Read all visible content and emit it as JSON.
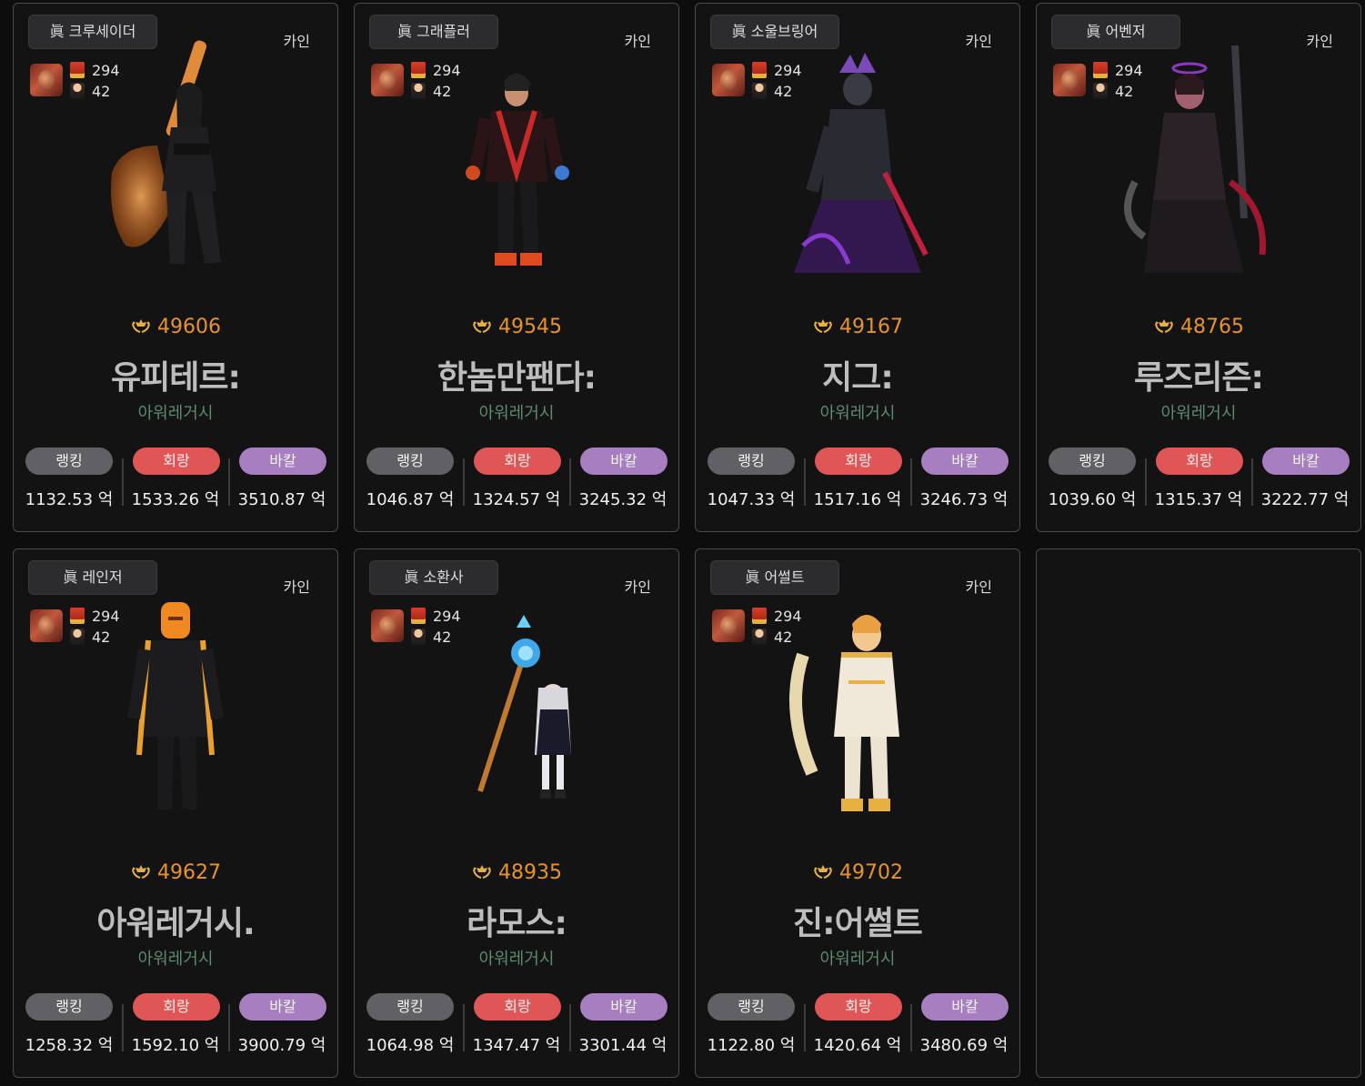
{
  "cards": [
    {
      "job": "眞 크루세이더",
      "server": "카인",
      "lv": "294",
      "lv2": "42",
      "fame": "49606",
      "name": "유피테르:",
      "guild": "아워레거시",
      "buttons": [
        "랭킹",
        "회랑",
        "바칼"
      ],
      "values": [
        "1132.53 억",
        "1533.26 억",
        "3510.87 억"
      ]
    },
    {
      "job": "眞 그래플러",
      "server": "카인",
      "lv": "294",
      "lv2": "42",
      "fame": "49545",
      "name": "한놈만팬다:",
      "guild": "아워레거시",
      "buttons": [
        "랭킹",
        "회랑",
        "바칼"
      ],
      "values": [
        "1046.87 억",
        "1324.57 억",
        "3245.32 억"
      ]
    },
    {
      "job": "眞 소울브링어",
      "server": "카인",
      "lv": "294",
      "lv2": "42",
      "fame": "49167",
      "name": "지그:",
      "guild": "아워레거시",
      "buttons": [
        "랭킹",
        "회랑",
        "바칼"
      ],
      "values": [
        "1047.33 억",
        "1517.16 억",
        "3246.73 억"
      ]
    },
    {
      "job": "眞 어벤저",
      "server": "카인",
      "lv": "294",
      "lv2": "42",
      "fame": "48765",
      "name": "루즈리즌:",
      "guild": "아워레거시",
      "buttons": [
        "랭킹",
        "회랑",
        "바칼"
      ],
      "values": [
        "1039.60 억",
        "1315.37 억",
        "3222.77 억"
      ]
    },
    {
      "job": "眞 레인저",
      "server": "카인",
      "lv": "294",
      "lv2": "42",
      "fame": "49627",
      "name": "아워레거시.",
      "guild": "아워레거시",
      "buttons": [
        "랭킹",
        "회랑",
        "바칼"
      ],
      "values": [
        "1258.32 억",
        "1592.10 억",
        "3900.79 억"
      ]
    },
    {
      "job": "眞 소환사",
      "server": "카인",
      "lv": "294",
      "lv2": "42",
      "fame": "48935",
      "name": "라모스:",
      "guild": "아워레거시",
      "buttons": [
        "랭킹",
        "회랑",
        "바칼"
      ],
      "values": [
        "1064.98 억",
        "1347.47 억",
        "3301.44 억"
      ]
    },
    {
      "job": "眞 어썰트",
      "server": "카인",
      "lv": "294",
      "lv2": "42",
      "fame": "49702",
      "name": "진:어썰트",
      "guild": "아워레거시",
      "buttons": [
        "랭킹",
        "회랑",
        "바칼"
      ],
      "values": [
        "1122.80 억",
        "1420.64 억",
        "3480.69 억"
      ]
    }
  ],
  "colors": {
    "fame": "#e8932a",
    "guild": "#5d8a6e",
    "rank_btn": "#616165",
    "corr_btn": "#e05556",
    "bakal_btn": "#a77ebf"
  },
  "icons": {
    "fame": "crown-laurel-icon",
    "level": "medal-icon",
    "sub": "mini-character-icon"
  }
}
